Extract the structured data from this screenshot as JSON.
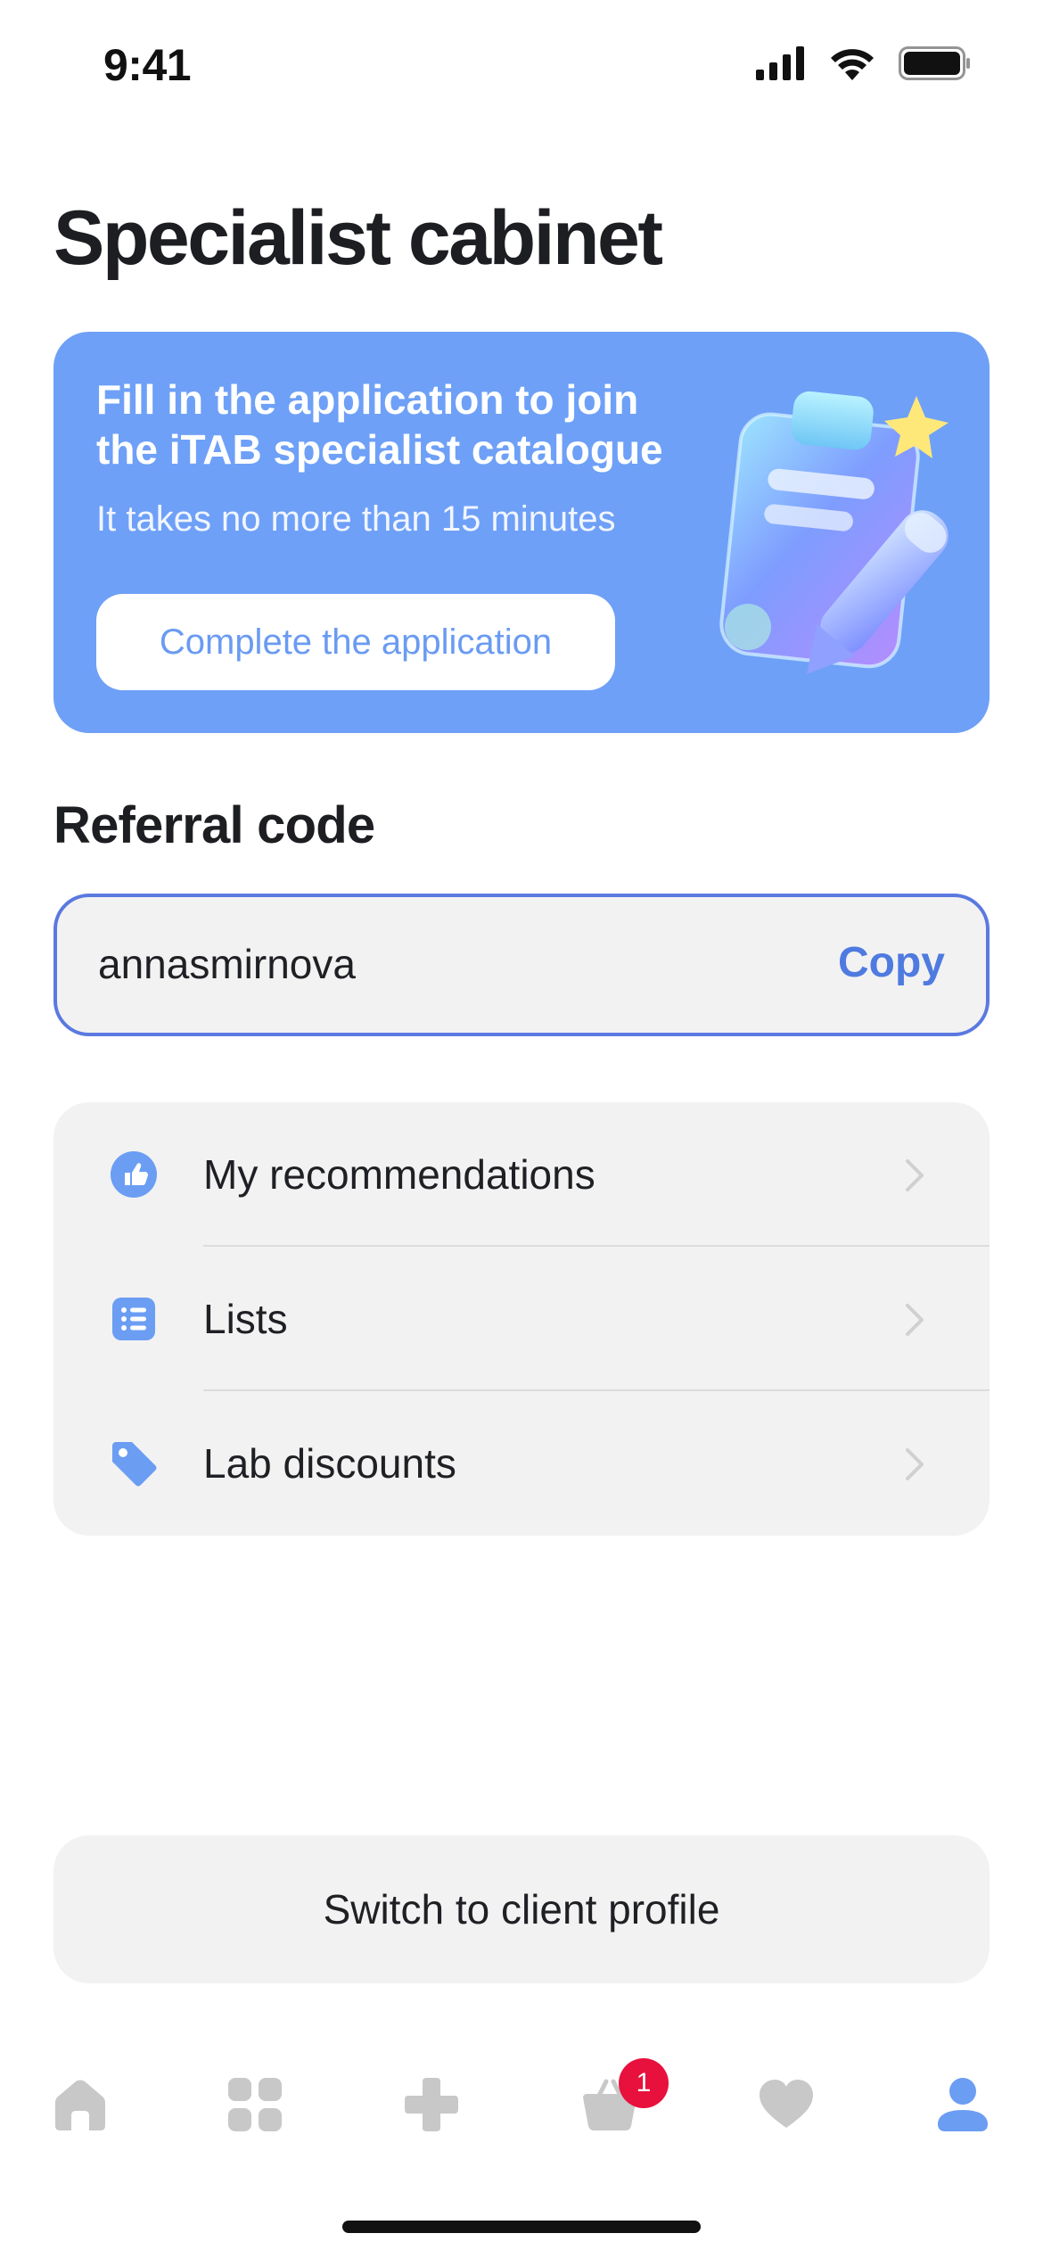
{
  "status_bar": {
    "time": "9:41"
  },
  "page": {
    "title": "Specialist cabinet"
  },
  "promo": {
    "title": "Fill in the application to join the iTAB specialist catalogue",
    "subtitle": "It takes no more than 15 minutes",
    "button_label": "Complete the application",
    "background_color": "#6ea0f7"
  },
  "referral": {
    "section_title": "Referral code",
    "code": "annasmirnova",
    "copy_label": "Copy"
  },
  "menu": {
    "items": [
      {
        "label": "My recommendations",
        "icon": "thumbs-up-icon"
      },
      {
        "label": "Lists",
        "icon": "list-icon"
      },
      {
        "label": "Lab discounts",
        "icon": "tag-icon"
      }
    ]
  },
  "switch_profile": {
    "label": "Switch to client profile"
  },
  "tab_bar": {
    "tabs": [
      {
        "name": "home",
        "icon": "home-icon",
        "active": false
      },
      {
        "name": "catalog",
        "icon": "grid-icon",
        "active": false
      },
      {
        "name": "services",
        "icon": "plus-icon",
        "active": false
      },
      {
        "name": "cart",
        "icon": "basket-icon",
        "active": false,
        "badge": "1"
      },
      {
        "name": "favorites",
        "icon": "heart-icon",
        "active": false
      },
      {
        "name": "profile",
        "icon": "user-icon",
        "active": true
      }
    ]
  },
  "colors": {
    "accent": "#6ea0f7",
    "link": "#4f7be0",
    "badge": "#e8103c",
    "inactive_icon": "#c8c8c8"
  }
}
